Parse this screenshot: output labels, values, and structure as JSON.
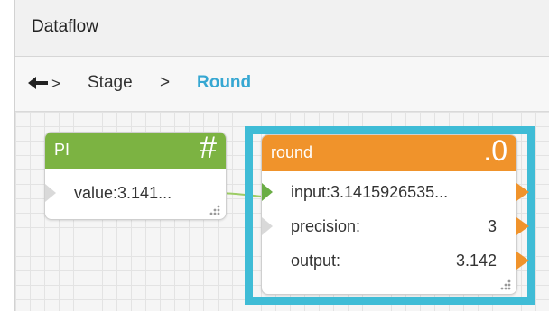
{
  "window": {
    "title": "Dataflow"
  },
  "breadcrumb": {
    "items": [
      "Stage",
      "Round"
    ],
    "separator": ">"
  },
  "nodes": {
    "pi": {
      "title": "PI",
      "glyph": "#",
      "header_color": "#7cb342",
      "ports": [
        {
          "label": "value:3.141..."
        }
      ]
    },
    "round": {
      "title": "round",
      "glyph": ".0",
      "header_color": "#f0932b",
      "ports": [
        {
          "label": "input:3.1415926535...",
          "value": ""
        },
        {
          "label": "precision:",
          "value": "3"
        },
        {
          "label": "output:",
          "value": "3.142"
        }
      ]
    }
  },
  "colors": {
    "selection": "#3fbcd6",
    "link": "#9ccc65",
    "accent": "#36a7d2"
  }
}
